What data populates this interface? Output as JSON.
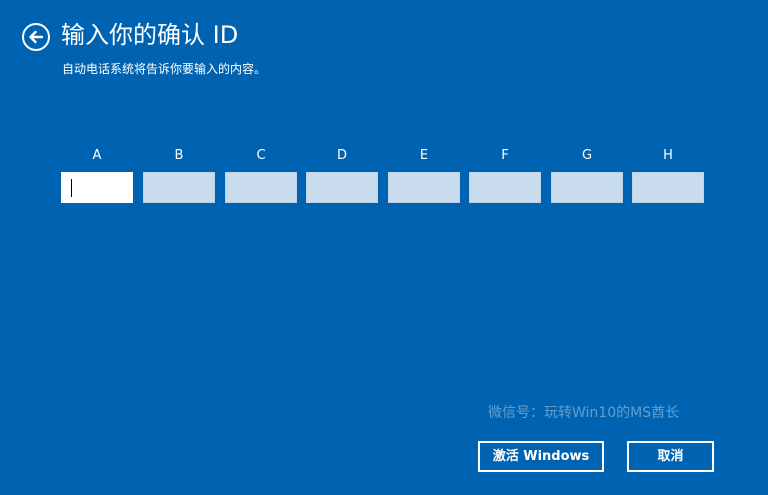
{
  "header": {
    "back_icon": "back-arrow-circle-icon",
    "title": "输入你的确认 ID",
    "subtitle": "自动电话系统将告诉你要输入的内容。"
  },
  "id_groups": [
    {
      "label": "A",
      "value": ""
    },
    {
      "label": "B",
      "value": ""
    },
    {
      "label": "C",
      "value": ""
    },
    {
      "label": "D",
      "value": ""
    },
    {
      "label": "E",
      "value": ""
    },
    {
      "label": "F",
      "value": ""
    },
    {
      "label": "G",
      "value": ""
    },
    {
      "label": "H",
      "value": ""
    }
  ],
  "watermark": "微信号：玩转Win10的MS酋长",
  "buttons": {
    "activate_label": "激活 Windows",
    "cancel_label": "取消"
  },
  "colors": {
    "background": "#0063b1",
    "text": "#ffffff",
    "input_inactive": "#c9dcee",
    "input_active": "#ffffff"
  }
}
